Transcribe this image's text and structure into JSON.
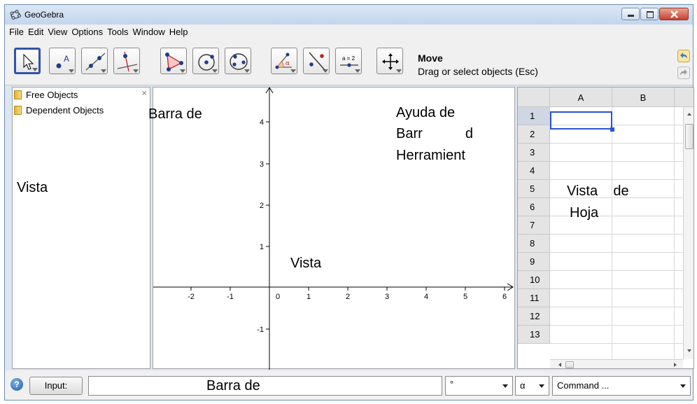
{
  "window": {
    "title": "GeoGebra"
  },
  "menu": [
    "File",
    "Edit",
    "View",
    "Options",
    "Tools",
    "Window",
    "Help"
  ],
  "toolbar": {
    "tools": [
      "move-tool",
      "point-tool",
      "line-tool",
      "perpendicular-line-tool",
      "polygon-tool",
      "circle-tool",
      "conic-tool",
      "angle-tool",
      "reflect-tool",
      "slider-tool",
      "move-graphics-view-tool"
    ],
    "slider_icon_text": "a = 2",
    "help_title": "Move",
    "help_desc": "Drag or select objects (Esc)"
  },
  "algebra": {
    "items": [
      "Free Objects",
      "Dependent Objects"
    ],
    "close": "×"
  },
  "graphics": {
    "x_ticks": [
      "-2",
      "-1",
      "0",
      "1",
      "2",
      "3",
      "4",
      "5",
      "6"
    ],
    "y_ticks": [
      "4",
      "3",
      "2",
      "1",
      "-1"
    ]
  },
  "spreadsheet": {
    "columns": [
      "A",
      "B"
    ],
    "rows": [
      "1",
      "2",
      "3",
      "4",
      "5",
      "6",
      "7",
      "8",
      "9",
      "10",
      "11",
      "12",
      "13"
    ],
    "selected_cell": "A1"
  },
  "overlays": {
    "barra_de_top": "Barra de",
    "ayuda_de": "Ayuda    de",
    "barr_d": "Barr           d",
    "herramient": "Herramient",
    "vista_left": "Vista",
    "vista_center": "Vista",
    "vista_de": "Vista    de",
    "hoja": "Hoja",
    "barra_de_bottom": "Barra de"
  },
  "inputbar": {
    "input_label": "Input:",
    "degree": "°",
    "alpha": "α",
    "command": "Command ..."
  }
}
